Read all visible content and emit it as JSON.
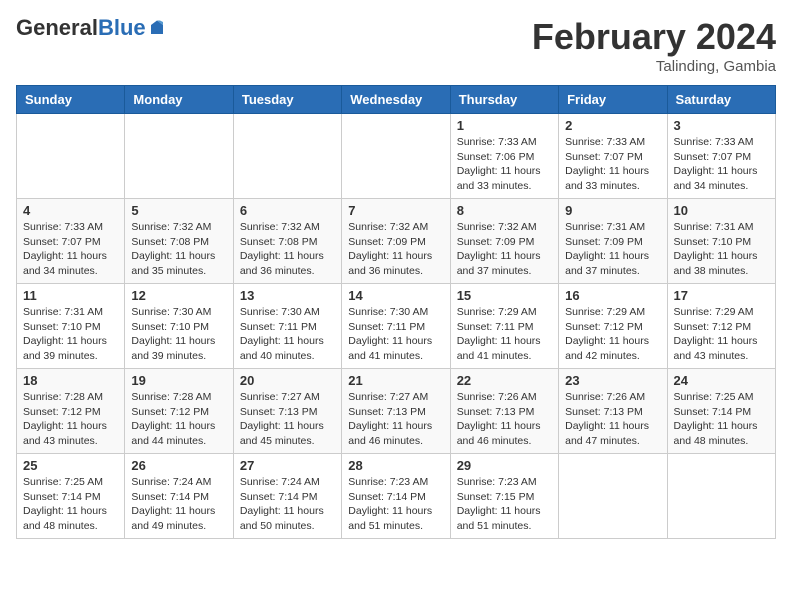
{
  "header": {
    "logo_general": "General",
    "logo_blue": "Blue",
    "month_title": "February 2024",
    "location": "Talinding, Gambia"
  },
  "days_of_week": [
    "Sunday",
    "Monday",
    "Tuesday",
    "Wednesday",
    "Thursday",
    "Friday",
    "Saturday"
  ],
  "weeks": [
    [
      {
        "day": "",
        "info": ""
      },
      {
        "day": "",
        "info": ""
      },
      {
        "day": "",
        "info": ""
      },
      {
        "day": "",
        "info": ""
      },
      {
        "day": "1",
        "info": "Sunrise: 7:33 AM\nSunset: 7:06 PM\nDaylight: 11 hours and 33 minutes."
      },
      {
        "day": "2",
        "info": "Sunrise: 7:33 AM\nSunset: 7:07 PM\nDaylight: 11 hours and 33 minutes."
      },
      {
        "day": "3",
        "info": "Sunrise: 7:33 AM\nSunset: 7:07 PM\nDaylight: 11 hours and 34 minutes."
      }
    ],
    [
      {
        "day": "4",
        "info": "Sunrise: 7:33 AM\nSunset: 7:07 PM\nDaylight: 11 hours and 34 minutes."
      },
      {
        "day": "5",
        "info": "Sunrise: 7:32 AM\nSunset: 7:08 PM\nDaylight: 11 hours and 35 minutes."
      },
      {
        "day": "6",
        "info": "Sunrise: 7:32 AM\nSunset: 7:08 PM\nDaylight: 11 hours and 36 minutes."
      },
      {
        "day": "7",
        "info": "Sunrise: 7:32 AM\nSunset: 7:09 PM\nDaylight: 11 hours and 36 minutes."
      },
      {
        "day": "8",
        "info": "Sunrise: 7:32 AM\nSunset: 7:09 PM\nDaylight: 11 hours and 37 minutes."
      },
      {
        "day": "9",
        "info": "Sunrise: 7:31 AM\nSunset: 7:09 PM\nDaylight: 11 hours and 37 minutes."
      },
      {
        "day": "10",
        "info": "Sunrise: 7:31 AM\nSunset: 7:10 PM\nDaylight: 11 hours and 38 minutes."
      }
    ],
    [
      {
        "day": "11",
        "info": "Sunrise: 7:31 AM\nSunset: 7:10 PM\nDaylight: 11 hours and 39 minutes."
      },
      {
        "day": "12",
        "info": "Sunrise: 7:30 AM\nSunset: 7:10 PM\nDaylight: 11 hours and 39 minutes."
      },
      {
        "day": "13",
        "info": "Sunrise: 7:30 AM\nSunset: 7:11 PM\nDaylight: 11 hours and 40 minutes."
      },
      {
        "day": "14",
        "info": "Sunrise: 7:30 AM\nSunset: 7:11 PM\nDaylight: 11 hours and 41 minutes."
      },
      {
        "day": "15",
        "info": "Sunrise: 7:29 AM\nSunset: 7:11 PM\nDaylight: 11 hours and 41 minutes."
      },
      {
        "day": "16",
        "info": "Sunrise: 7:29 AM\nSunset: 7:12 PM\nDaylight: 11 hours and 42 minutes."
      },
      {
        "day": "17",
        "info": "Sunrise: 7:29 AM\nSunset: 7:12 PM\nDaylight: 11 hours and 43 minutes."
      }
    ],
    [
      {
        "day": "18",
        "info": "Sunrise: 7:28 AM\nSunset: 7:12 PM\nDaylight: 11 hours and 43 minutes."
      },
      {
        "day": "19",
        "info": "Sunrise: 7:28 AM\nSunset: 7:12 PM\nDaylight: 11 hours and 44 minutes."
      },
      {
        "day": "20",
        "info": "Sunrise: 7:27 AM\nSunset: 7:13 PM\nDaylight: 11 hours and 45 minutes."
      },
      {
        "day": "21",
        "info": "Sunrise: 7:27 AM\nSunset: 7:13 PM\nDaylight: 11 hours and 46 minutes."
      },
      {
        "day": "22",
        "info": "Sunrise: 7:26 AM\nSunset: 7:13 PM\nDaylight: 11 hours and 46 minutes."
      },
      {
        "day": "23",
        "info": "Sunrise: 7:26 AM\nSunset: 7:13 PM\nDaylight: 11 hours and 47 minutes."
      },
      {
        "day": "24",
        "info": "Sunrise: 7:25 AM\nSunset: 7:14 PM\nDaylight: 11 hours and 48 minutes."
      }
    ],
    [
      {
        "day": "25",
        "info": "Sunrise: 7:25 AM\nSunset: 7:14 PM\nDaylight: 11 hours and 48 minutes."
      },
      {
        "day": "26",
        "info": "Sunrise: 7:24 AM\nSunset: 7:14 PM\nDaylight: 11 hours and 49 minutes."
      },
      {
        "day": "27",
        "info": "Sunrise: 7:24 AM\nSunset: 7:14 PM\nDaylight: 11 hours and 50 minutes."
      },
      {
        "day": "28",
        "info": "Sunrise: 7:23 AM\nSunset: 7:14 PM\nDaylight: 11 hours and 51 minutes."
      },
      {
        "day": "29",
        "info": "Sunrise: 7:23 AM\nSunset: 7:15 PM\nDaylight: 11 hours and 51 minutes."
      },
      {
        "day": "",
        "info": ""
      },
      {
        "day": "",
        "info": ""
      }
    ]
  ]
}
